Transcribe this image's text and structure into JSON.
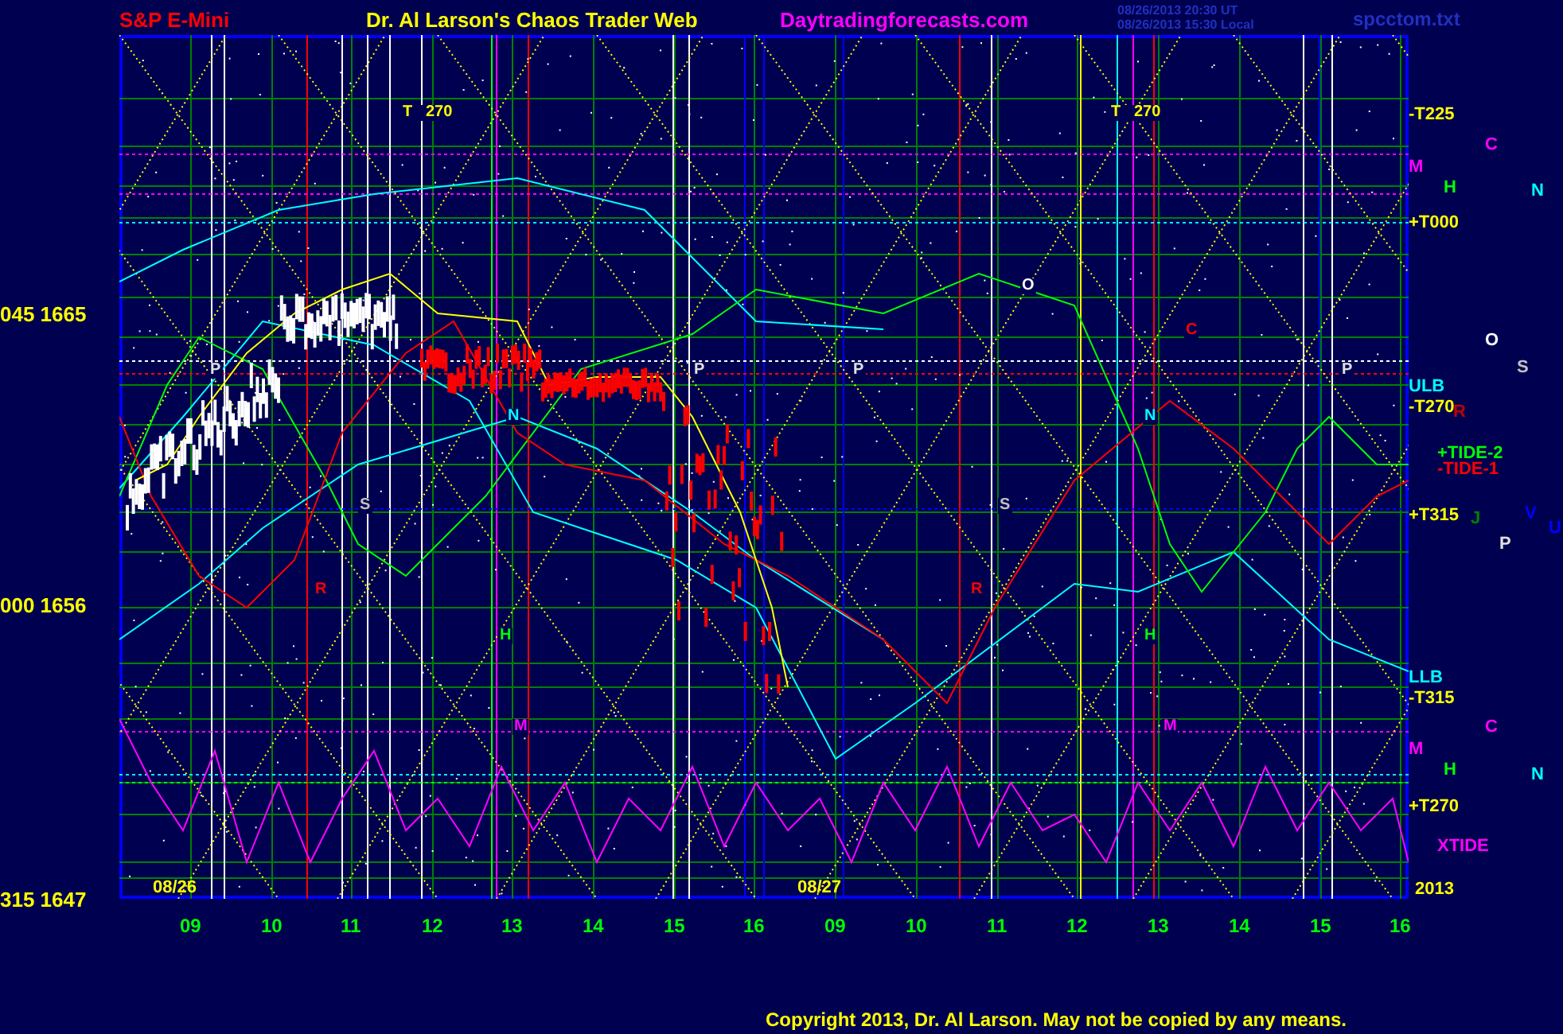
{
  "header": {
    "instrument": "S&P E-Mini",
    "title": "Dr. Al Larson's Chaos Trader Web",
    "site": "Daytradingforecasts.com",
    "time_ut": "08/26/2013 20:30 UT",
    "time_local": "08/26/2013 15:30 Local",
    "file": "spcctom.txt"
  },
  "price_axis": [
    "045 1665",
    "000 1656",
    "315 1647"
  ],
  "right_labels": [
    {
      "text": "-T225",
      "color": "#ffff00"
    },
    {
      "text": "C",
      "color": "#ff00ff"
    },
    {
      "text": "M",
      "color": "#ff00ff"
    },
    {
      "text": "H",
      "color": "#00ff00"
    },
    {
      "text": "N",
      "color": "#00ffff"
    },
    {
      "text": "+T000",
      "color": "#ffff00"
    },
    {
      "text": "O",
      "color": "#ffffff"
    },
    {
      "text": "S",
      "color": "#c0c0c0"
    },
    {
      "text": "ULB",
      "color": "#00ffff"
    },
    {
      "text": "-T270",
      "color": "#ffff00"
    },
    {
      "text": "R",
      "color": "#c00000"
    },
    {
      "text": "+TIDE-2",
      "color": "#00ff00"
    },
    {
      "text": "-TIDE-1",
      "color": "#ff0000"
    },
    {
      "text": "+T315",
      "color": "#ffff00"
    },
    {
      "text": "J",
      "color": "#008000"
    },
    {
      "text": "V",
      "color": "#0000ff"
    },
    {
      "text": "U",
      "color": "#0000ff"
    },
    {
      "text": "P",
      "color": "#e0e0e0"
    },
    {
      "text": "LLB",
      "color": "#00ffff"
    },
    {
      "text": "-T315",
      "color": "#ffff00"
    },
    {
      "text": "C",
      "color": "#ff00ff"
    },
    {
      "text": "M",
      "color": "#ff00ff"
    },
    {
      "text": "H",
      "color": "#00ff00"
    },
    {
      "text": "N",
      "color": "#00ffff"
    },
    {
      "text": "+T270",
      "color": "#ffff00"
    },
    {
      "text": "XTIDE",
      "color": "#ff00ff"
    }
  ],
  "plot_labels": [
    {
      "text": "T   270",
      "color": "#ffff00"
    },
    {
      "text": "T   270",
      "color": "#ffff00"
    },
    {
      "text": "P",
      "color": "#e0e0e0"
    },
    {
      "text": "P",
      "color": "#e0e0e0"
    },
    {
      "text": "P",
      "color": "#e0e0e0"
    },
    {
      "text": "P",
      "color": "#e0e0e0"
    },
    {
      "text": "O",
      "color": "#ffffff"
    },
    {
      "text": "C",
      "color": "#ff0000"
    },
    {
      "text": "N",
      "color": "#00ffff"
    },
    {
      "text": "N",
      "color": "#00ffff"
    },
    {
      "text": "S",
      "color": "#c0c0c0"
    },
    {
      "text": "S",
      "color": "#c0c0c0"
    },
    {
      "text": "R",
      "color": "#ff0000"
    },
    {
      "text": "R",
      "color": "#ff0000"
    },
    {
      "text": "H",
      "color": "#00ff00"
    },
    {
      "text": "H",
      "color": "#00ff00"
    },
    {
      "text": "M",
      "color": "#ff00ff"
    },
    {
      "text": "M",
      "color": "#ff00ff"
    }
  ],
  "date_labels": [
    "08/26",
    "08/27",
    "2013"
  ],
  "hour_ticks": [
    "09",
    "10",
    "11",
    "12",
    "13",
    "14",
    "15",
    "16",
    "09",
    "10",
    "11",
    "12",
    "13",
    "14",
    "15",
    "16"
  ],
  "copyright": "Copyright 2013, Dr. Al Larson. May not be copied by any means."
}
